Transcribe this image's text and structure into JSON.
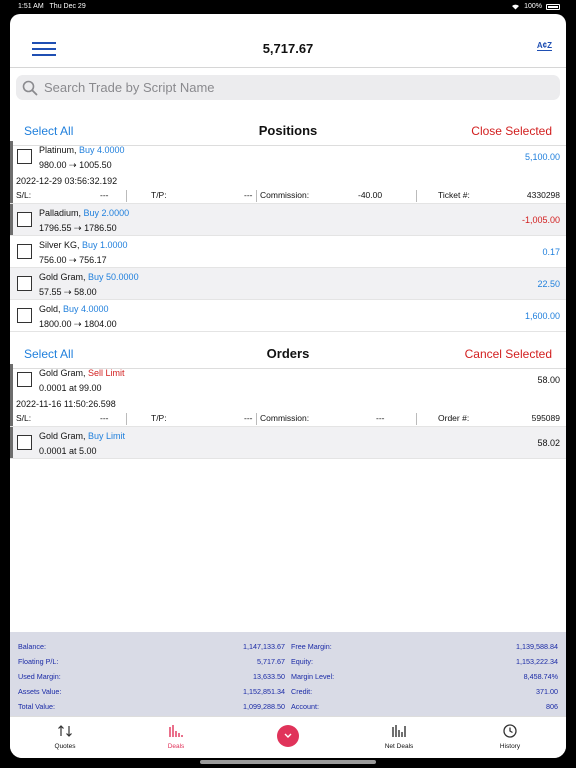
{
  "status_bar": {
    "time": "1:51 AM",
    "date": "Thu Dec 29",
    "battery": "100%"
  },
  "header": {
    "title": "5,717.67",
    "sort_label": "A¢Z"
  },
  "search": {
    "placeholder": "Search Trade by Script Name",
    "value": ""
  },
  "positions": {
    "select_all": "Select All",
    "title": "Positions",
    "close_selected": "Close Selected",
    "rows": [
      {
        "name": "Platinum",
        "side": "Buy 4.0000",
        "prices": "980.00 ⇢ 1005.50",
        "value": "5,100.00",
        "timestamp": "2022-12-29 03:56:32.192",
        "sl_label": "S/L:",
        "sl": "---",
        "tp_label": "T/P:",
        "tp": "---",
        "comm_label": "Commission:",
        "comm": "-40.00",
        "ticket_label": "Ticket #:",
        "ticket": "4330298"
      },
      {
        "name": "Palladium",
        "side": "Buy 2.0000",
        "prices": "1796.55 ⇢ 1786.50",
        "value": "-1,005.00"
      },
      {
        "name": "Silver KG",
        "side": "Buy 1.0000",
        "prices": "756.00 ⇢ 756.17",
        "value": "0.17"
      },
      {
        "name": "Gold Gram",
        "side": "Buy 50.0000",
        "prices": "57.55 ⇢ 58.00",
        "value": "22.50"
      },
      {
        "name": "Gold",
        "side": "Buy 4.0000",
        "prices": "1800.00 ⇢ 1804.00",
        "value": "1,600.00"
      }
    ]
  },
  "orders": {
    "select_all": "Select All",
    "title": "Orders",
    "cancel_selected": "Cancel Selected",
    "rows": [
      {
        "name": "Gold Gram",
        "side": "Sell Limit",
        "prices": "0.0001 at 99.00",
        "value": "58.00",
        "timestamp": "2022-11-16 11:50:26.598",
        "sl_label": "S/L:",
        "sl": "---",
        "tp_label": "T/P:",
        "tp": "---",
        "comm_label": "Commission:",
        "comm": "---",
        "order_label": "Order #:",
        "order": "595089"
      },
      {
        "name": "Gold Gram",
        "side": "Buy Limit",
        "prices": "0.0001 at 5.00",
        "value": "58.02"
      }
    ]
  },
  "summary": {
    "balance_label": "Balance:",
    "balance": "1,147,133.67",
    "free_margin_label": "Free Margin:",
    "free_margin": "1,139,588.84",
    "floating_label": "Floating P/L:",
    "floating": "5,717.67",
    "equity_label": "Equity:",
    "equity": "1,153,222.34",
    "used_margin_label": "Used Margin:",
    "used_margin": "13,633.50",
    "margin_level_label": "Margin Level:",
    "margin_level": "8,458.74%",
    "assets_label": "Assets Value:",
    "assets": "1,152,851.34",
    "credit_label": "Credit:",
    "credit": "371.00",
    "total_label": "Total Value:",
    "total": "1,099,288.50",
    "account_label": "Account:",
    "account": "806"
  },
  "tabs": {
    "quotes": "Quotes",
    "deals": "Deals",
    "net_deals": "Net Deals",
    "history": "History"
  },
  "colors": {
    "accent_blue": "#1f7fdc",
    "sell_red": "#d21f1f",
    "active_tab": "#e0335a",
    "summary_bg": "#d9dbe6",
    "summary_text": "#1a2aa6"
  }
}
